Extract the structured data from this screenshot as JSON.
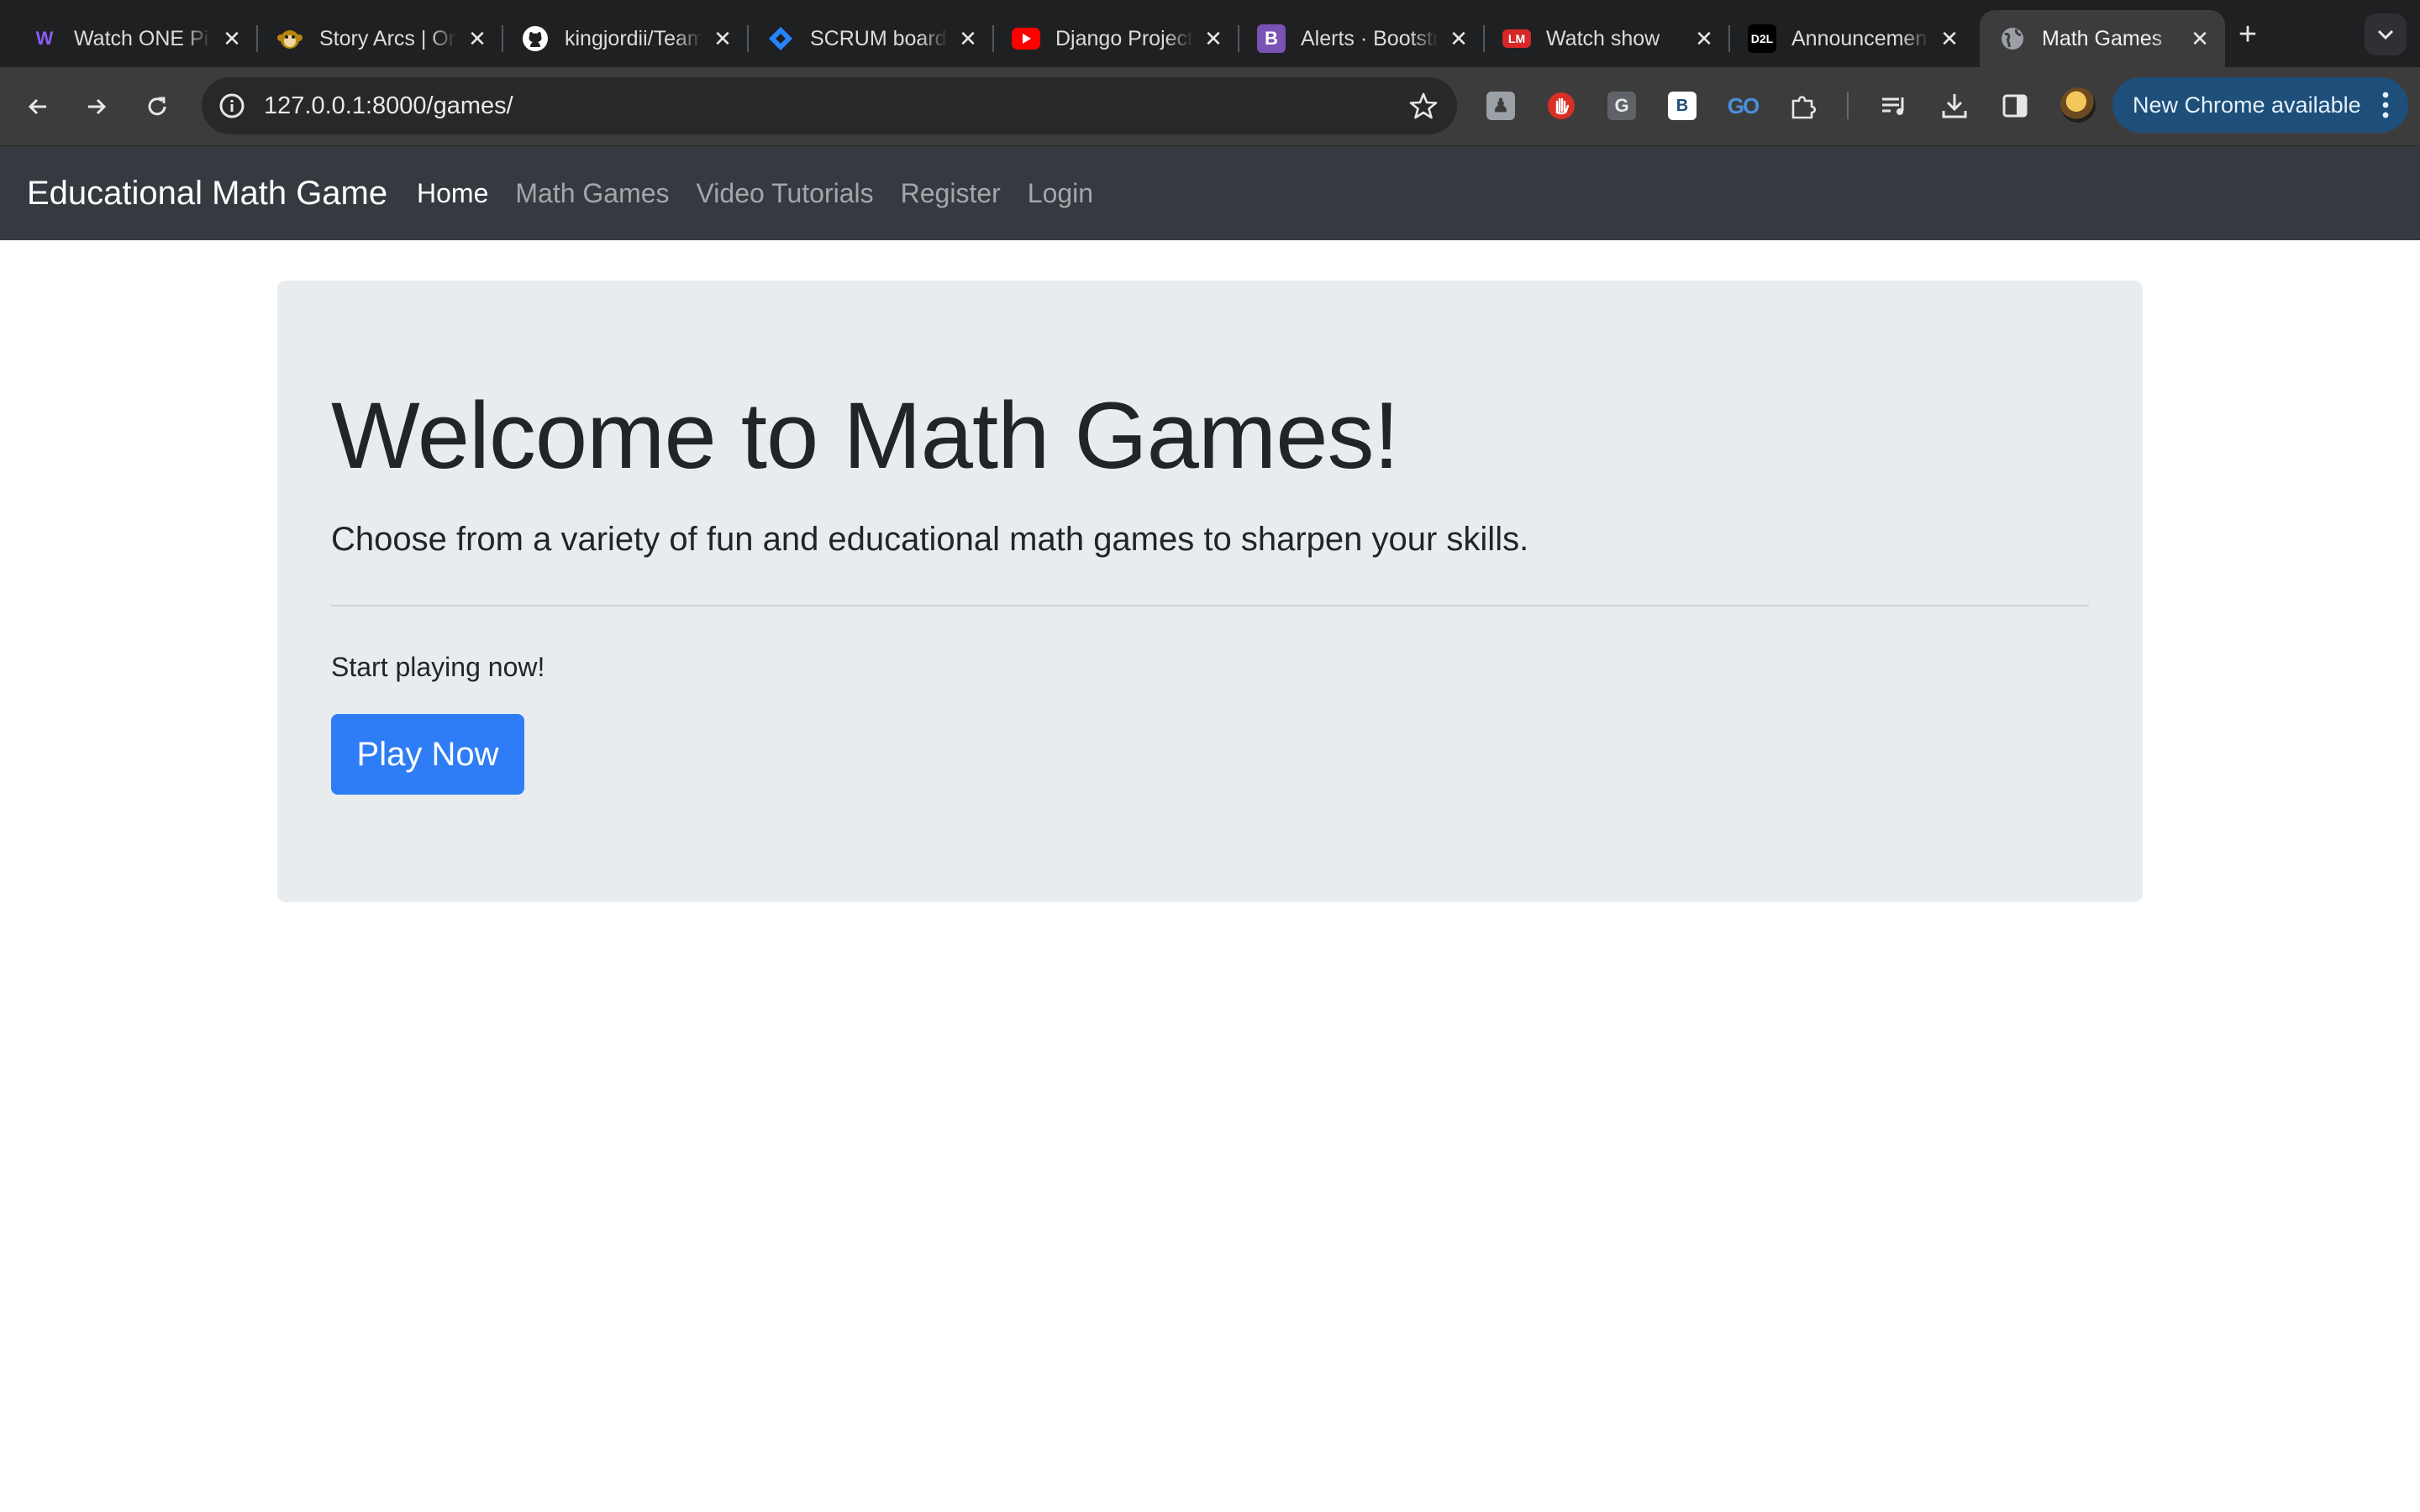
{
  "browser": {
    "tabs": [
      {
        "title": "Watch ONE Piece",
        "favicon": "w-logo-icon",
        "favicon_color": "#8b5cf6",
        "active": false
      },
      {
        "title": "Story Arcs | One Piece",
        "favicon": "monkey-icon",
        "favicon_color": "#b8860b",
        "active": false
      },
      {
        "title": "kingjordii/Team",
        "favicon": "github-icon",
        "favicon_color": "#ffffff",
        "active": false
      },
      {
        "title": "SCRUM board",
        "favicon": "jira-icon",
        "favicon_color": "#2684ff",
        "active": false
      },
      {
        "title": "Django Project",
        "favicon": "youtube-icon",
        "favicon_color": "#ff0000",
        "active": false
      },
      {
        "title": "Alerts · Bootstrap",
        "favicon": "bootstrap-icon",
        "favicon_color": "#7952b3",
        "active": false
      },
      {
        "title": "Watch show",
        "favicon": "lm-icon",
        "favicon_color": "#d62828",
        "active": false
      },
      {
        "title": "Announcements",
        "favicon": "d2l-icon",
        "favicon_color": "#000000",
        "active": false
      },
      {
        "title": "Math Games",
        "favicon": "globe-icon",
        "favicon_color": "#9aa0a6",
        "active": true
      }
    ],
    "address": {
      "url": "127.0.0.1:8000/games/"
    },
    "update_chip": "New Chrome available",
    "extensions": [
      {
        "name": "figure-ext-icon",
        "label": "",
        "bg": "#9aa0a6"
      },
      {
        "name": "hand-ext-icon",
        "label": "",
        "bg": "#d93025"
      },
      {
        "name": "g-ext-icon",
        "label": "G",
        "bg": "#5f6368"
      },
      {
        "name": "b-ext-icon",
        "label": "B",
        "bg": "#ffffff"
      },
      {
        "name": "go-ext-icon",
        "label": "GO",
        "bg": "transparent"
      },
      {
        "name": "puzzle-icon",
        "label": "",
        "bg": "transparent"
      }
    ]
  },
  "site": {
    "brand": "Educational Math Game",
    "nav": [
      {
        "label": "Home",
        "active": true
      },
      {
        "label": "Math Games",
        "active": false
      },
      {
        "label": "Video Tutorials",
        "active": false
      },
      {
        "label": "Register",
        "active": false
      },
      {
        "label": "Login",
        "active": false
      }
    ]
  },
  "hero": {
    "heading": "Welcome to Math Games!",
    "lead": "Choose from a variety of fun and educational math games to sharpen your skills.",
    "cta_text": "Start playing now!",
    "button_label": "Play Now",
    "button_color": "#2f7df6"
  }
}
